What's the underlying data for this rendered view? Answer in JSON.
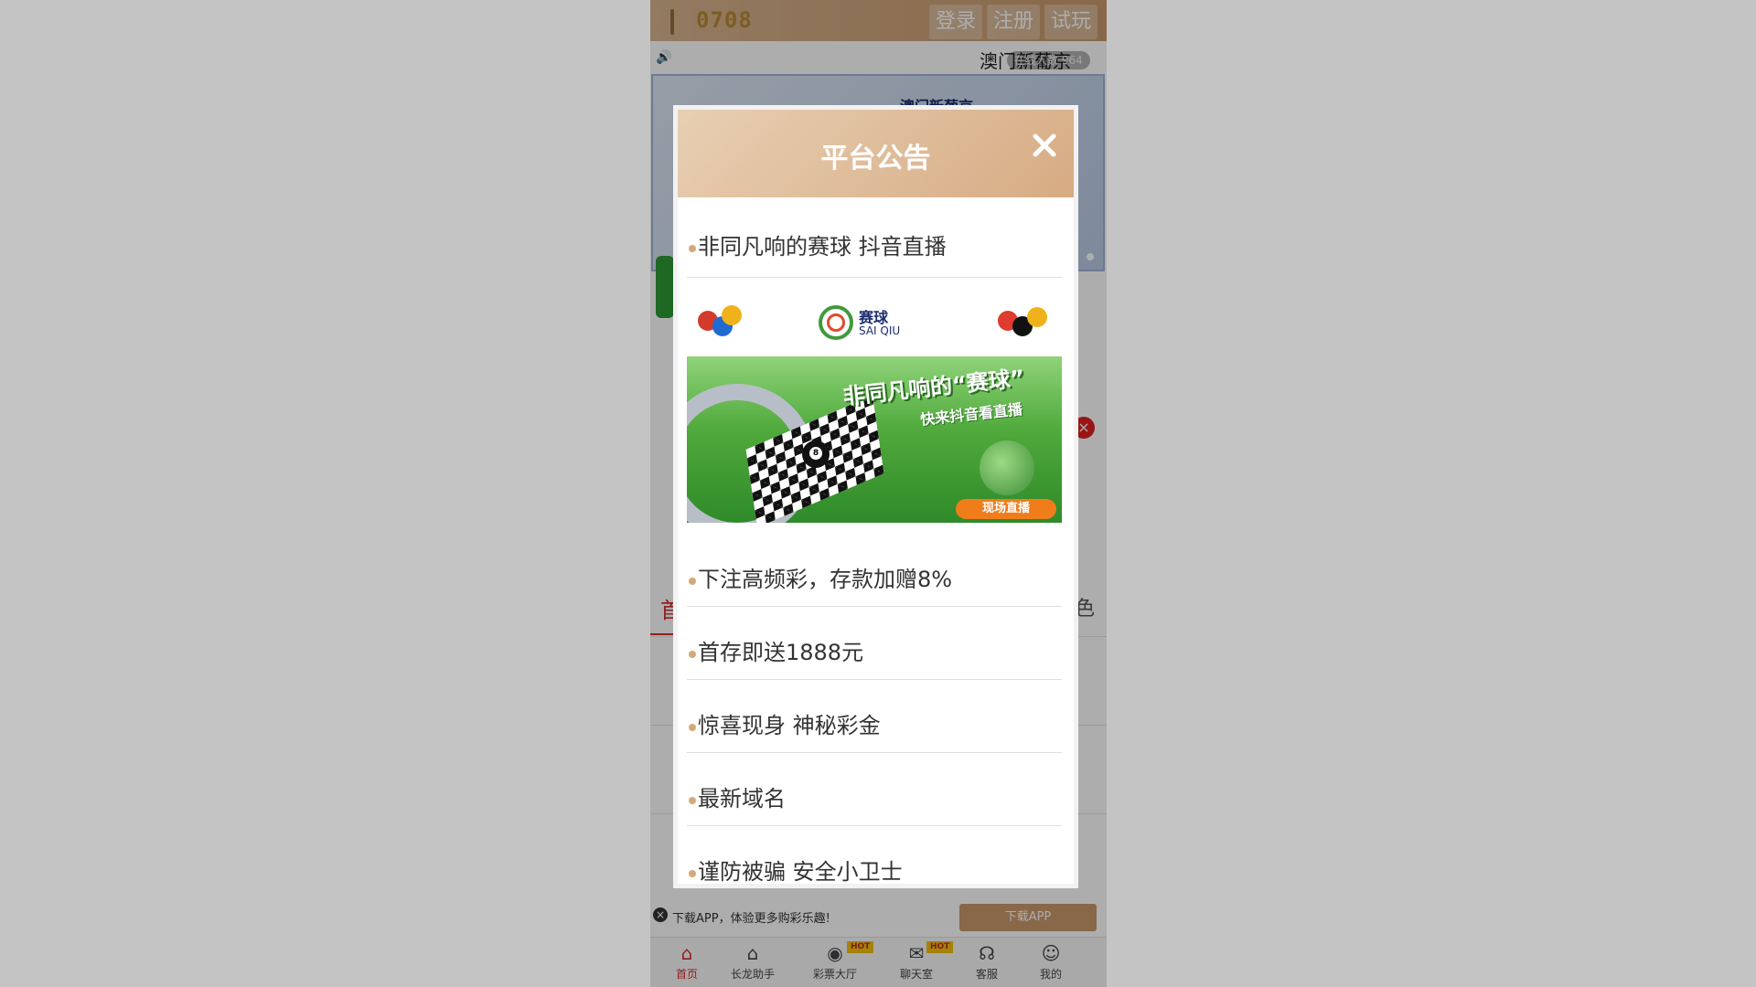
{
  "header": {
    "logo_text": "0708",
    "login_label": "登录",
    "register_label": "注册",
    "trial_label": "试玩"
  },
  "ticker": {
    "text": "澳门新葡京",
    "online_badge": "在线人数 964"
  },
  "banner": {
    "text": "澳门新葡京"
  },
  "nav": {
    "home_tab_partial": "首",
    "right_tab_partial": "色"
  },
  "download": {
    "text": "下载APP，体验更多购彩乐趣!",
    "button": "下载APP"
  },
  "bottom_nav": [
    {
      "label": "首页",
      "icon": "home-icon"
    },
    {
      "label": "长龙助手",
      "icon": "home-icon"
    },
    {
      "label": "彩票大厅",
      "icon": "palette-icon",
      "badge": "HOT"
    },
    {
      "label": "聊天室",
      "icon": "chat-icon",
      "badge": "HOT"
    },
    {
      "label": "客服",
      "icon": "headset-icon"
    },
    {
      "label": "我的",
      "icon": "user-icon"
    }
  ],
  "modal": {
    "title": "平台公告",
    "items": [
      "非同凡响的赛球 抖音直播",
      "下注高频彩，存款加赠8%",
      "首存即送1888元",
      "惊喜现身 神秘彩金",
      "最新域名",
      "谨防被骗 安全小卫士"
    ],
    "promo": {
      "brand_cn": "赛球",
      "brand_en": "SAI QIU",
      "headline": "非同凡响的“赛球”",
      "subline": "快来抖音看直播",
      "button": "现场直播",
      "ball_number": "8"
    }
  },
  "colors": {
    "accent_gold": "#d6ab83",
    "active_red": "#d52d2d",
    "overlay": "rgba(0,0,0,0.32)"
  }
}
